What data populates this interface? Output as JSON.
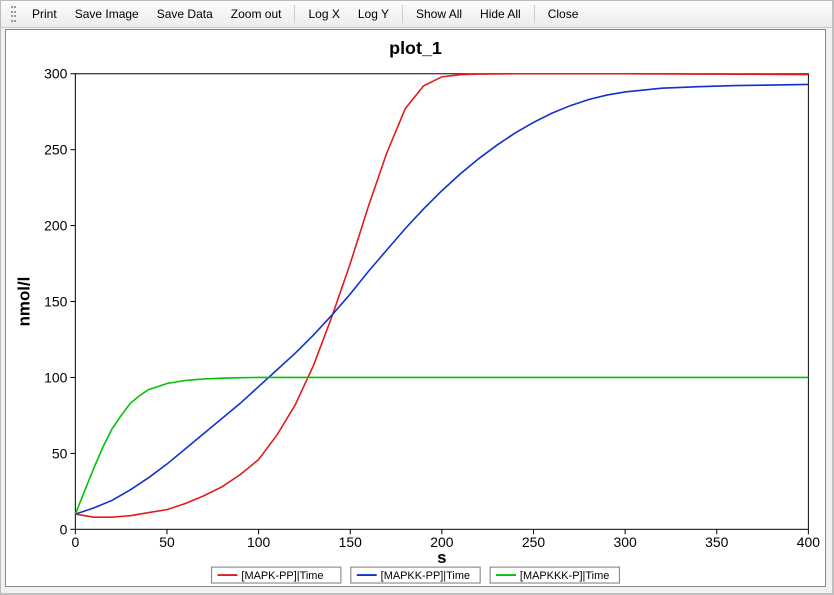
{
  "toolbar": {
    "print": "Print",
    "save_image": "Save Image",
    "save_data": "Save Data",
    "zoom_out": "Zoom out",
    "log_x": "Log X",
    "log_y": "Log Y",
    "show_all": "Show All",
    "hide_all": "Hide All",
    "close": "Close"
  },
  "chart_data": {
    "type": "line",
    "title": "plot_1",
    "ylabel": "nmol/l",
    "xlabel": "s",
    "xlim": [
      0,
      400
    ],
    "ylim": [
      0,
      300
    ],
    "x_ticks": [
      0,
      50,
      100,
      150,
      200,
      250,
      300,
      350,
      400
    ],
    "y_ticks": [
      0,
      50,
      100,
      150,
      200,
      250,
      300
    ],
    "series": [
      {
        "name": "[MAPK-PP]|Time",
        "color": "#e11b1b",
        "x": [
          0,
          10,
          20,
          30,
          40,
          50,
          60,
          70,
          80,
          90,
          100,
          110,
          120,
          130,
          140,
          150,
          160,
          170,
          180,
          190,
          200,
          210,
          220,
          230,
          240,
          260,
          300,
          400
        ],
        "values": [
          10,
          8,
          8,
          9,
          11,
          13,
          17,
          22,
          28,
          36,
          46,
          62,
          82,
          108,
          140,
          175,
          213,
          248,
          277,
          292,
          298,
          299.4,
          299.8,
          299.9,
          300,
          300,
          300,
          299.5
        ]
      },
      {
        "name": "[MAPKK-PP]|Time",
        "color": "#1030d0",
        "x": [
          0,
          10,
          20,
          30,
          40,
          50,
          60,
          70,
          80,
          90,
          100,
          110,
          120,
          130,
          140,
          150,
          160,
          170,
          180,
          190,
          200,
          210,
          220,
          230,
          240,
          250,
          260,
          270,
          280,
          290,
          300,
          320,
          340,
          360,
          400
        ],
        "values": [
          10,
          14,
          19,
          26,
          34,
          43,
          53,
          63,
          73,
          83,
          94,
          105,
          116,
          128,
          141,
          155,
          170,
          184,
          198,
          211,
          223,
          234,
          244,
          253,
          261,
          268,
          274,
          279,
          283,
          286,
          288,
          290.5,
          291.5,
          292.2,
          293
        ]
      },
      {
        "name": "[MAPKKK-P]|Time",
        "color": "#00c400",
        "x": [
          0,
          5,
          10,
          15,
          20,
          25,
          30,
          35,
          40,
          45,
          50,
          55,
          60,
          65,
          70,
          80,
          90,
          100,
          150,
          250,
          400
        ],
        "values": [
          10,
          25,
          40,
          54,
          66,
          75,
          83,
          88,
          92,
          94,
          96,
          97,
          98,
          98.5,
          99,
          99.5,
          99.8,
          100,
          100,
          100,
          100
        ]
      }
    ],
    "legend": [
      {
        "color": "#e11b1b",
        "label": "[MAPK-PP]|Time"
      },
      {
        "color": "#1030d0",
        "label": "[MAPKK-PP]|Time"
      },
      {
        "color": "#00c400",
        "label": "[MAPKKK-P]|Time"
      }
    ]
  }
}
